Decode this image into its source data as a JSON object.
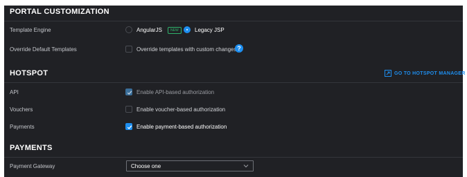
{
  "portal": {
    "title": "PORTAL CUSTOMIZATION",
    "template_engine_label": "Template Engine",
    "option_angular": "AngularJS",
    "new_badge": "NEW",
    "option_legacy": "Legacy JSP",
    "selected_engine": "Legacy JSP",
    "override_label": "Override Default Templates",
    "override_checkbox_label": "Override templates with custom changes",
    "override_checked": false,
    "help_icon": "?"
  },
  "hotspot": {
    "title": "HOTSPOT",
    "manager_link": "GO TO HOTSPOT MANAGER",
    "api_label": "API",
    "api_checkbox_label": "Enable API-based authorization",
    "api_checked": true,
    "vouchers_label": "Vouchers",
    "vouchers_checkbox_label": "Enable voucher-based authorization",
    "vouchers_checked": false,
    "payments_label": "Payments",
    "payments_checkbox_label": "Enable payment-based authorization",
    "payments_checked": true
  },
  "payments": {
    "title": "PAYMENTS",
    "gateway_label": "Payment Gateway",
    "gateway_value": "Choose one"
  },
  "colors": {
    "background": "#202125",
    "accent": "#1e8ff0",
    "new_badge": "#2fb36b"
  },
  "icons": [
    "help-icon",
    "external-link-icon",
    "checkmark-icon",
    "chevron-down-icon"
  ]
}
